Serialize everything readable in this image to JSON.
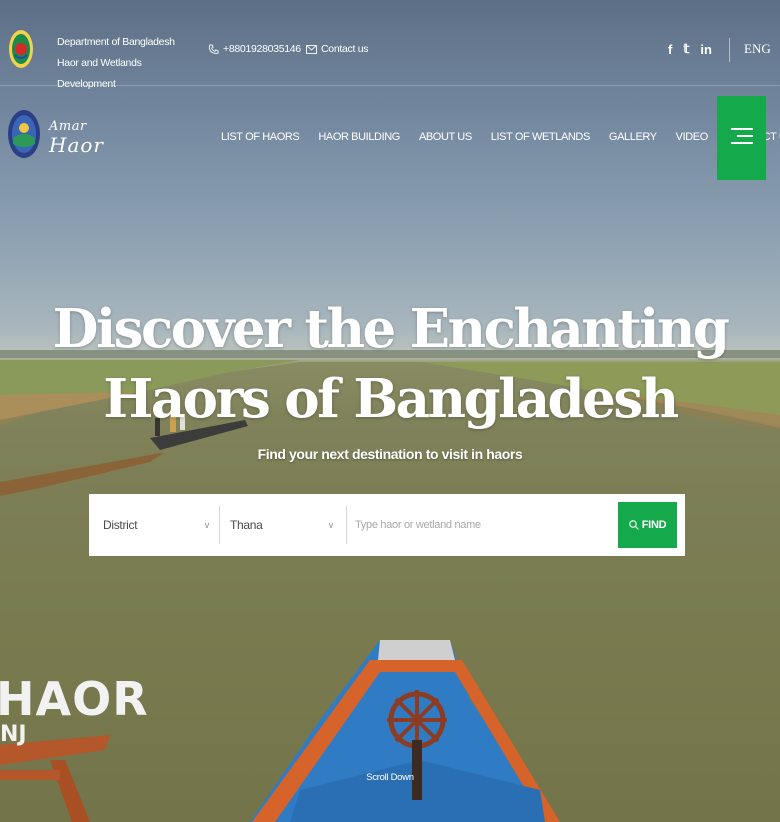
{
  "topbar": {
    "department": "Department of Bangladesh Haor and Wetlands Development",
    "phone": "+8801928035146",
    "contact_label": "Contact us",
    "socials": [
      "f",
      "𝕥",
      "in"
    ],
    "language": "ENG"
  },
  "logo": {
    "line1": "Amar",
    "line2": "Haor"
  },
  "nav": {
    "items": [
      "LIST OF HAORS",
      "HAOR BUILDING",
      "ABOUT US",
      "LIST OF WETLANDS",
      "GALLERY",
      "VIDEO",
      "CONTACT US"
    ]
  },
  "hero": {
    "title_line1": "Discover the Enchanting",
    "title_line2": "Haors of Bangladesh",
    "subtitle": "Find your next destination to visit in haors"
  },
  "search": {
    "district": "District",
    "thana": "Thana",
    "placeholder": "Type haor or wetland name",
    "find_label": "FIND"
  },
  "background": {
    "sign_line1": "HAOR",
    "sign_line2": "NJ"
  },
  "scroll_label": "Scroll Down",
  "colors": {
    "accent": "#14a94a",
    "boat_blue": "#2f7cc4",
    "boat_orange": "#d6642a"
  },
  "icons": {
    "phone": "phone-icon",
    "mail": "mail-icon",
    "menu": "hamburger-menu-icon",
    "search": "search-icon"
  }
}
